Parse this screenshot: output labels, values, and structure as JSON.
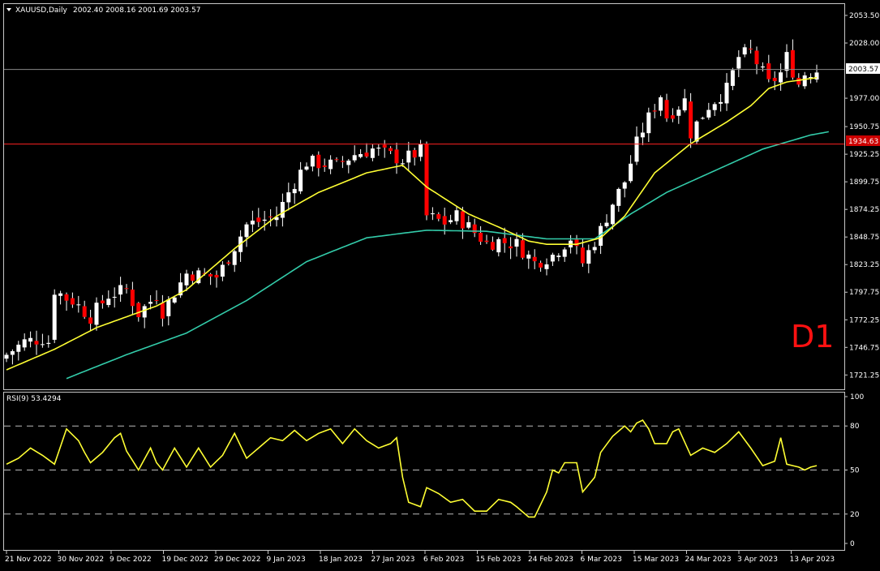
{
  "header": {
    "symbol_label": "XAUUSD,Daily",
    "ohlc_label": "2002.40 2008.16 2001.69 2003.57"
  },
  "rsi_header": {
    "label": "RSI(9) 53.4294"
  },
  "badge": {
    "text": "D1"
  },
  "colors": {
    "background": "#000000",
    "bull_candle": "#ffffff",
    "bear_candle": "#ff0000",
    "wick": "#ffffff",
    "ma_fast": "#ffff33",
    "ma_slow": "#33ccaa",
    "rsi_line": "#ffff33",
    "current_price_line": "#888888",
    "hline": "#ff2222",
    "badge": "#ff1111",
    "text": "#ffffff"
  },
  "chart_data": [
    {
      "type": "candlestick",
      "symbol": "XAUUSD",
      "timeframe": "Daily",
      "ylim": [
        1708,
        2064
      ],
      "y_ticks": [
        "2053.50",
        "2028.00",
        "1977.00",
        "1950.75",
        "1925.25",
        "1899.75",
        "1874.25",
        "1848.75",
        "1823.25",
        "1797.75",
        "1772.25",
        "1746.75",
        "1721.25"
      ],
      "current_price": "2003.57",
      "horizontal_line": "1934.63",
      "x_labels": [
        "21 Nov 2022",
        "30 Nov 2022",
        "9 Dec 2022",
        "19 Dec 2022",
        "29 Dec 2022",
        "9 Jan 2023",
        "18 Jan 2023",
        "27 Jan 2023",
        "6 Feb 2023",
        "15 Feb 2023",
        "24 Feb 2023",
        "6 Mar 2023",
        "15 Mar 2023",
        "24 Mar 2023",
        "3 Apr 2023",
        "13 Apr 2023"
      ],
      "close_anchors": [
        [
          0,
          1740
        ],
        [
          3,
          1752
        ],
        [
          6,
          1755
        ],
        [
          7,
          1752
        ],
        [
          8,
          1800
        ],
        [
          10,
          1792
        ],
        [
          11,
          1790
        ],
        [
          14,
          1775
        ],
        [
          17,
          1795
        ],
        [
          20,
          1800
        ],
        [
          22,
          1778
        ],
        [
          25,
          1795
        ],
        [
          26,
          1780
        ],
        [
          30,
          1815
        ],
        [
          35,
          1812
        ],
        [
          36,
          1820
        ],
        [
          40,
          1860
        ],
        [
          45,
          1868
        ],
        [
          47,
          1890
        ],
        [
          50,
          1918
        ],
        [
          55,
          1915
        ],
        [
          58,
          1925
        ],
        [
          61,
          1930
        ],
        [
          63,
          1926
        ],
        [
          66,
          1920
        ],
        [
          69,
          1928
        ],
        [
          70,
          1868
        ],
        [
          73,
          1862
        ],
        [
          75,
          1868
        ],
        [
          80,
          1843
        ],
        [
          82,
          1845
        ],
        [
          85,
          1842
        ],
        [
          88,
          1825
        ],
        [
          91,
          1832
        ],
        [
          94,
          1848
        ],
        [
          95,
          1835
        ],
        [
          96,
          1825
        ],
        [
          99,
          1855
        ],
        [
          101,
          1880
        ],
        [
          103,
          1900
        ],
        [
          105,
          1935
        ],
        [
          106,
          1948
        ],
        [
          109,
          1980
        ],
        [
          110,
          1960
        ],
        [
          111,
          1965
        ],
        [
          113,
          1975
        ],
        [
          114,
          1945
        ],
        [
          117,
          1970
        ],
        [
          120,
          1985
        ],
        [
          122,
          2015
        ],
        [
          124,
          2020
        ],
        [
          127,
          1990
        ],
        [
          129,
          2000
        ],
        [
          130,
          2015
        ],
        [
          132,
          1990
        ],
        [
          133,
          2000
        ],
        [
          135,
          2003
        ]
      ],
      "ma_fast_anchors": [
        [
          0,
          1726
        ],
        [
          8,
          1745
        ],
        [
          15,
          1765
        ],
        [
          25,
          1785
        ],
        [
          30,
          1800
        ],
        [
          38,
          1838
        ],
        [
          45,
          1868
        ],
        [
          52,
          1890
        ],
        [
          60,
          1908
        ],
        [
          66,
          1915
        ],
        [
          70,
          1895
        ],
        [
          77,
          1870
        ],
        [
          82,
          1858
        ],
        [
          87,
          1845
        ],
        [
          90,
          1842
        ],
        [
          95,
          1842
        ],
        [
          99,
          1848
        ],
        [
          103,
          1868
        ],
        [
          108,
          1908
        ],
        [
          114,
          1935
        ],
        [
          120,
          1955
        ],
        [
          124,
          1970
        ],
        [
          127,
          1986
        ],
        [
          130,
          1992
        ],
        [
          135,
          1996
        ]
      ],
      "ma_slow_anchors": [
        [
          10,
          1718
        ],
        [
          20,
          1740
        ],
        [
          30,
          1760
        ],
        [
          40,
          1790
        ],
        [
          50,
          1826
        ],
        [
          60,
          1848
        ],
        [
          70,
          1855
        ],
        [
          80,
          1854
        ],
        [
          90,
          1847
        ],
        [
          98,
          1847
        ],
        [
          104,
          1870
        ],
        [
          110,
          1890
        ],
        [
          118,
          1910
        ],
        [
          126,
          1930
        ],
        [
          134,
          1943
        ],
        [
          137,
          1946
        ]
      ]
    },
    {
      "type": "line",
      "name": "RSI(9)",
      "last_value": "53.4294",
      "ylim": [
        0,
        100
      ],
      "y_ticks": [
        "100",
        "80",
        "50",
        "20",
        "0"
      ],
      "levels": [
        80,
        50,
        20
      ],
      "anchors": [
        [
          0,
          54
        ],
        [
          2,
          58
        ],
        [
          4,
          65
        ],
        [
          6,
          60
        ],
        [
          8,
          54
        ],
        [
          10,
          78
        ],
        [
          12,
          70
        ],
        [
          13,
          62
        ],
        [
          14,
          55
        ],
        [
          16,
          62
        ],
        [
          18,
          72
        ],
        [
          19,
          75
        ],
        [
          20,
          63
        ],
        [
          22,
          50
        ],
        [
          24,
          65
        ],
        [
          25,
          55
        ],
        [
          26,
          50
        ],
        [
          28,
          65
        ],
        [
          30,
          52
        ],
        [
          32,
          65
        ],
        [
          34,
          52
        ],
        [
          36,
          60
        ],
        [
          38,
          75
        ],
        [
          40,
          58
        ],
        [
          42,
          65
        ],
        [
          44,
          72
        ],
        [
          46,
          70
        ],
        [
          48,
          77
        ],
        [
          50,
          70
        ],
        [
          52,
          75
        ],
        [
          54,
          78
        ],
        [
          56,
          68
        ],
        [
          58,
          78
        ],
        [
          60,
          70
        ],
        [
          62,
          65
        ],
        [
          64,
          68
        ],
        [
          65,
          72
        ],
        [
          66,
          45
        ],
        [
          67,
          28
        ],
        [
          69,
          25
        ],
        [
          70,
          38
        ],
        [
          72,
          34
        ],
        [
          74,
          28
        ],
        [
          76,
          30
        ],
        [
          78,
          22
        ],
        [
          80,
          22
        ],
        [
          82,
          30
        ],
        [
          84,
          28
        ],
        [
          85,
          25
        ],
        [
          87,
          18
        ],
        [
          88,
          18
        ],
        [
          90,
          35
        ],
        [
          91,
          50
        ],
        [
          92,
          48
        ],
        [
          93,
          55
        ],
        [
          95,
          55
        ],
        [
          96,
          35
        ],
        [
          97,
          40
        ],
        [
          98,
          45
        ],
        [
          99,
          62
        ],
        [
          101,
          73
        ],
        [
          103,
          80
        ],
        [
          104,
          76
        ],
        [
          105,
          82
        ],
        [
          106,
          84
        ],
        [
          107,
          78
        ],
        [
          108,
          68
        ],
        [
          110,
          68
        ],
        [
          111,
          76
        ],
        [
          112,
          78
        ],
        [
          114,
          60
        ],
        [
          116,
          65
        ],
        [
          118,
          62
        ],
        [
          120,
          68
        ],
        [
          122,
          76
        ],
        [
          124,
          65
        ],
        [
          126,
          53
        ],
        [
          128,
          56
        ],
        [
          129,
          72
        ],
        [
          130,
          54
        ],
        [
          132,
          52
        ],
        [
          133,
          50
        ],
        [
          134,
          52
        ],
        [
          135,
          53
        ]
      ]
    }
  ]
}
